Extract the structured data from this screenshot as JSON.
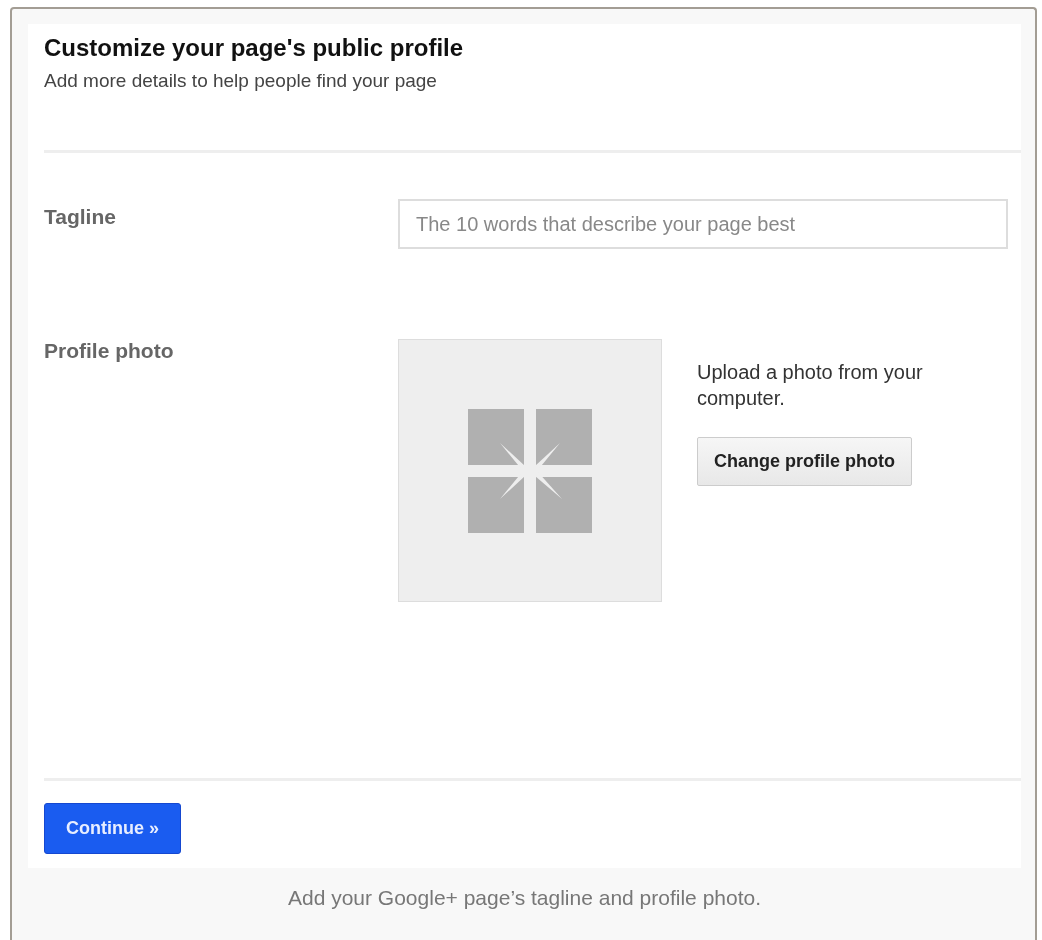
{
  "header": {
    "title": "Customize your page's public profile",
    "subtitle": "Add more details to help people find your page"
  },
  "tagline": {
    "label": "Tagline",
    "placeholder": "The 10 words that describe your page best"
  },
  "profile_photo": {
    "label": "Profile photo",
    "hint": "Upload a photo from your computer.",
    "button": "Change profile photo"
  },
  "continue_button": "Continue »",
  "caption": "Add your Google+ page’s tagline and profile photo."
}
